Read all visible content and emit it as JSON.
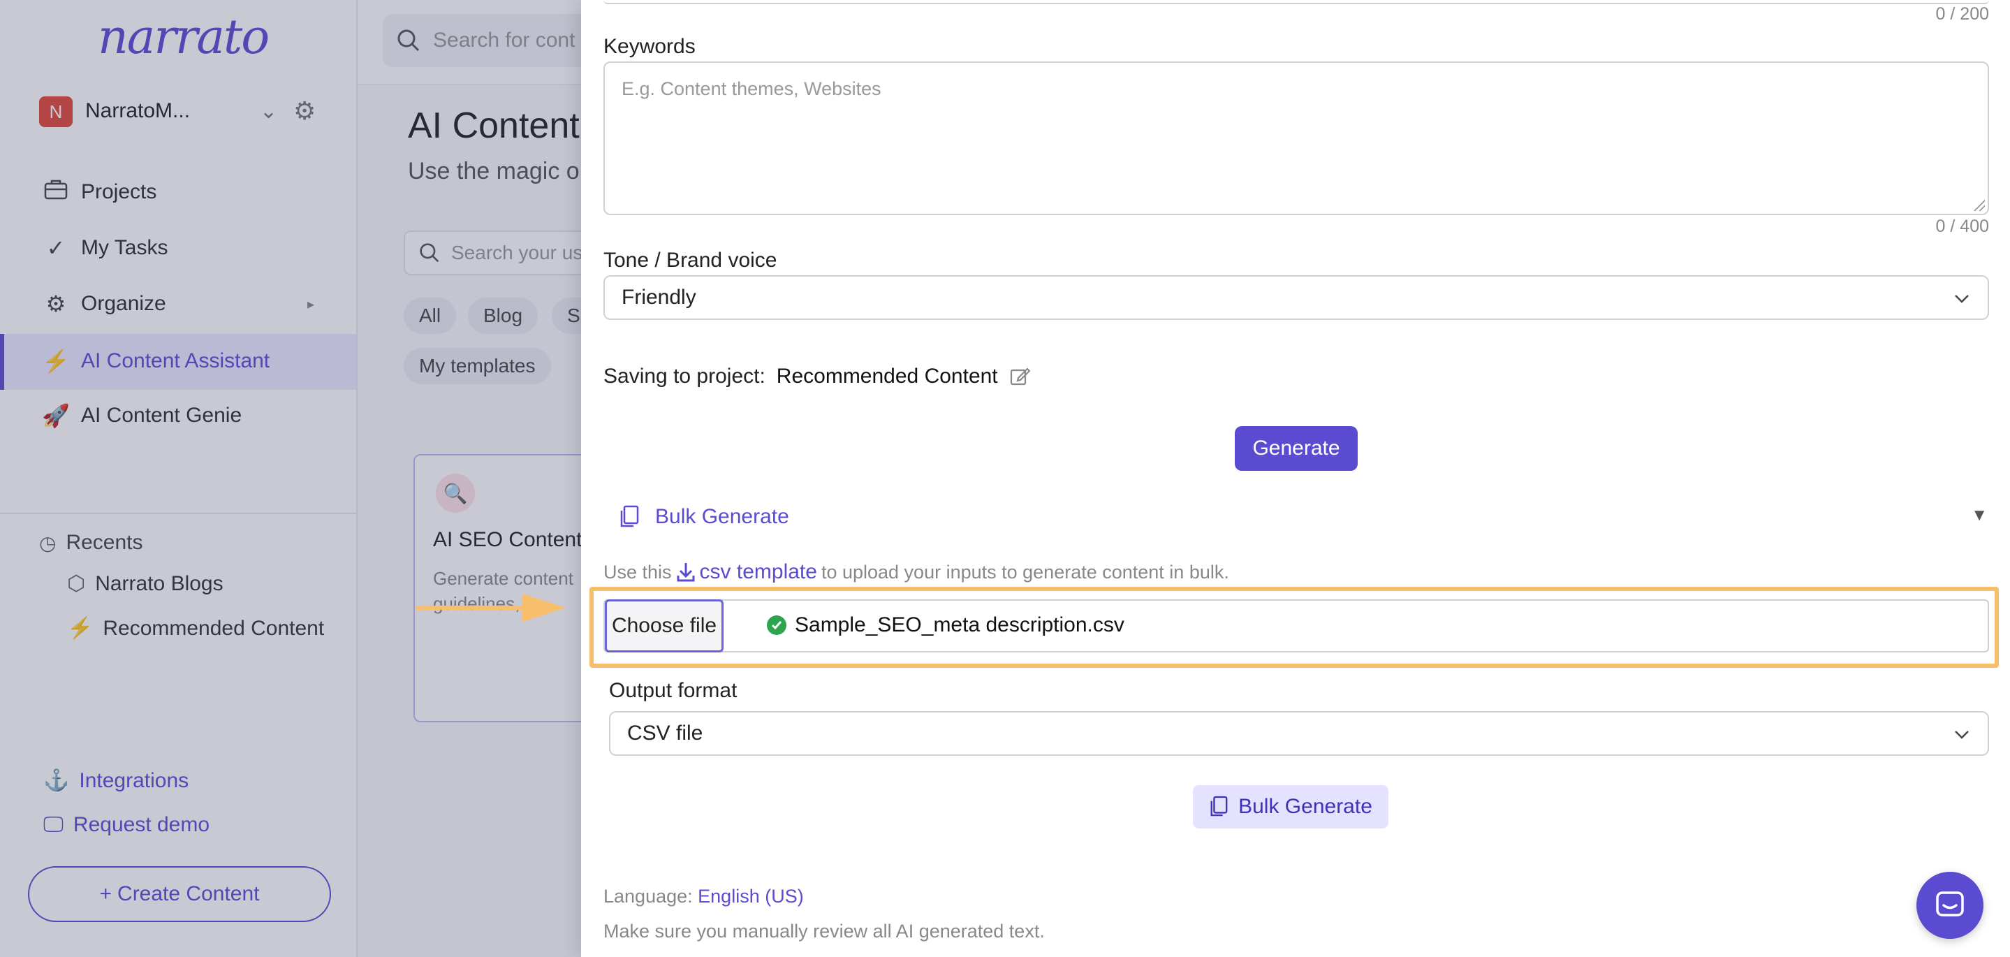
{
  "sidebar": {
    "logo": "narrato",
    "workspace": {
      "initial": "N",
      "name": "NarratoM..."
    },
    "nav": [
      {
        "label": "Projects",
        "icon": "briefcase-icon"
      },
      {
        "label": "My Tasks",
        "icon": "check-icon"
      },
      {
        "label": "Organize",
        "icon": "gears-icon"
      },
      {
        "label": "AI Content Assistant",
        "icon": "lightning-icon",
        "active": true
      },
      {
        "label": "AI Content Genie",
        "icon": "rocket-icon"
      }
    ],
    "recents_title": "Recents",
    "recents": [
      {
        "label": "Narrato Blogs",
        "icon": "cube-icon"
      },
      {
        "label": "Recommended Content",
        "icon": "lightning-icon"
      }
    ],
    "links": [
      {
        "label": "Integrations",
        "icon": "anchor-icon"
      },
      {
        "label": "Request demo",
        "icon": "monitor-icon"
      }
    ],
    "create_button": "Create Content"
  },
  "main": {
    "search_placeholder": "Search for cont",
    "title": "AI Content",
    "subtitle": "Use the magic o",
    "template_search_placeholder": "Search your us",
    "chips": [
      "All",
      "Blog",
      "S",
      "My templates"
    ],
    "card": {
      "title": "AI SEO Content",
      "desc": "Generate content guidelines, ke"
    }
  },
  "panel": {
    "top_counter": "0 / 200",
    "keywords": {
      "label": "Keywords",
      "placeholder": "E.g. Content themes, Websites",
      "counter": "0 / 400"
    },
    "tone": {
      "label": "Tone / Brand voice",
      "value": "Friendly"
    },
    "saving": {
      "label": "Saving to project:",
      "project": "Recommended Content"
    },
    "generate_button": "Generate",
    "bulk": {
      "title": "Bulk Generate",
      "hint_prefix": "Use this",
      "hint_link": "csv template",
      "hint_suffix": "to upload your inputs to generate content in bulk.",
      "choose_file": "Choose file",
      "file_name": "Sample_SEO_meta description.csv",
      "output_label": "Output format",
      "output_value": "CSV file",
      "bulk_button": "Bulk Generate"
    },
    "language_label": "Language:",
    "language_value": "English (US)",
    "disclaimer": "Make sure you manually review all AI generated text."
  },
  "colors": {
    "accent": "#5a4bd1",
    "highlight": "#f7be6b",
    "success": "#2ea44f"
  }
}
